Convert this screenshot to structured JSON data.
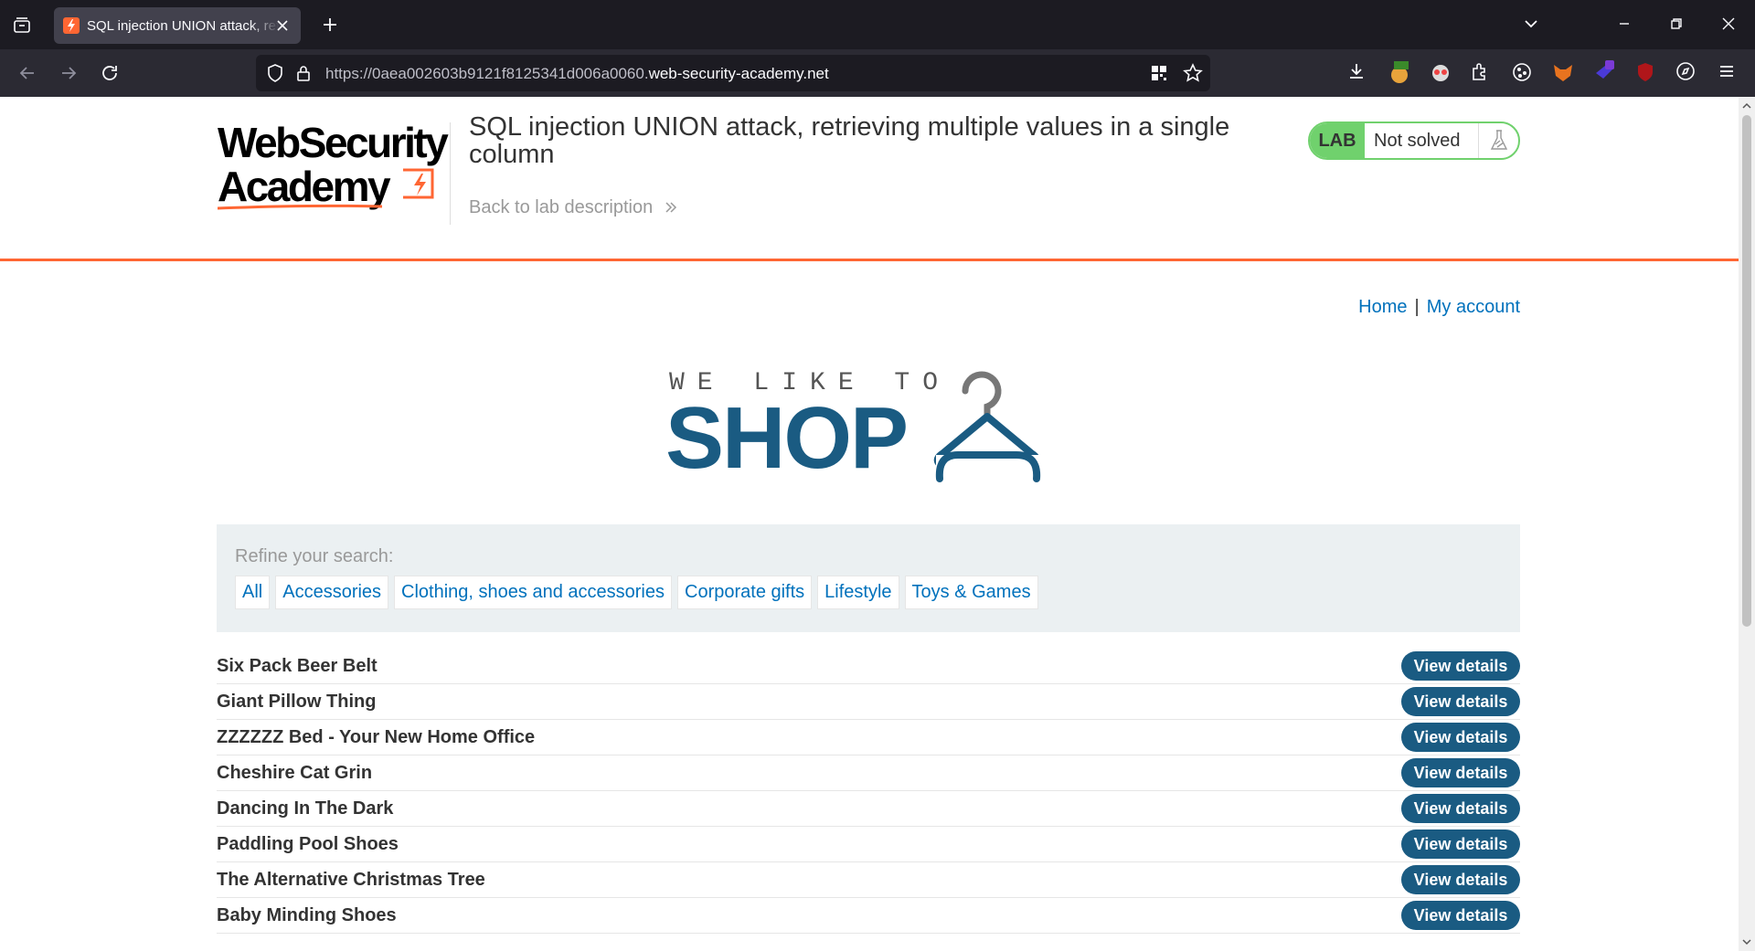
{
  "browser": {
    "tab_title": "SQL injection UNION attack, retrieving multiple values in a single column",
    "url_prefix": "https://0aea002603b9121f8125341d006a0060.",
    "url_host": "web-security-academy.net"
  },
  "lab": {
    "logo_line1": "WebSecurity",
    "logo_line2": "Academy",
    "title": "SQL injection UNION attack, retrieving multiple values in a single column",
    "back_link": "Back to lab description",
    "status_label": "LAB",
    "status_text": "Not solved"
  },
  "nav": {
    "home": "Home",
    "separator": "|",
    "my_account": "My account"
  },
  "shop_logo": {
    "line1": "WE LIKE TO",
    "line2": "SHOP"
  },
  "filters": {
    "label": "Refine your search:",
    "items": [
      "All",
      "Accessories",
      "Clothing, shoes and accessories",
      "Corporate gifts",
      "Lifestyle",
      "Toys & Games"
    ]
  },
  "products": [
    {
      "name": "Six Pack Beer Belt",
      "button": "View details"
    },
    {
      "name": "Giant Pillow Thing",
      "button": "View details"
    },
    {
      "name": "ZZZZZZ Bed - Your New Home Office",
      "button": "View details"
    },
    {
      "name": "Cheshire Cat Grin",
      "button": "View details"
    },
    {
      "name": "Dancing In The Dark",
      "button": "View details"
    },
    {
      "name": "Paddling Pool Shoes",
      "button": "View details"
    },
    {
      "name": "The Alternative Christmas Tree",
      "button": "View details"
    },
    {
      "name": "Baby Minding Shoes",
      "button": "View details"
    }
  ],
  "colors": {
    "accent_orange": "#ff6633",
    "link_blue": "#0071bc",
    "button_blue": "#1a5b82",
    "lab_green": "#70d16d"
  },
  "icons": [
    "tab-list-icon",
    "close-icon",
    "plus-icon",
    "chevron-down-icon",
    "minimize-icon",
    "restore-icon",
    "back-arrow-icon",
    "forward-arrow-icon",
    "reload-icon",
    "shield-icon",
    "lock-icon",
    "qr-code-icon",
    "star-icon",
    "download-icon",
    "extensions-icon",
    "menu-icon",
    "flask-icon",
    "hanger-icon",
    "double-chevron-right-icon"
  ]
}
